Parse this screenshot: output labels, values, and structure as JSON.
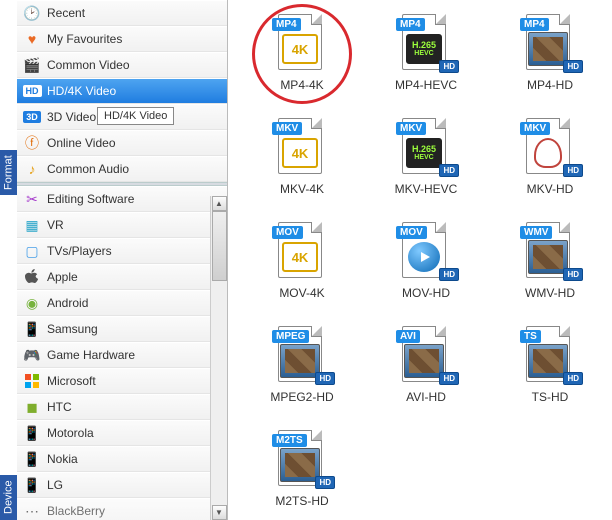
{
  "sidebar": {
    "format_tab": "Format",
    "device_tab": "Device",
    "items": [
      {
        "label": "Recent",
        "icon": "🕑"
      },
      {
        "label": "My Favourites",
        "icon": "♥"
      },
      {
        "label": "Common Video",
        "icon": "🎬"
      },
      {
        "label": "HD/4K Video",
        "icon": "HD"
      },
      {
        "label": "3D Video",
        "icon": "3D"
      },
      {
        "label": "Online Video",
        "icon": "ⓕ"
      },
      {
        "label": "Common Audio",
        "icon": "♪"
      },
      {
        "label": "Editing Software",
        "icon": "✂"
      },
      {
        "label": "VR",
        "icon": "▦"
      },
      {
        "label": "TVs/Players",
        "icon": "▢"
      },
      {
        "label": "Apple",
        "icon": ""
      },
      {
        "label": "Android",
        "icon": "◉"
      },
      {
        "label": "Samsung",
        "icon": "📱"
      },
      {
        "label": "Game Hardware",
        "icon": "🎮"
      },
      {
        "label": "Microsoft",
        "icon": "⊞"
      },
      {
        "label": "HTC",
        "icon": "◼"
      },
      {
        "label": "Motorola",
        "icon": "📱"
      },
      {
        "label": "Nokia",
        "icon": "📱"
      },
      {
        "label": "LG",
        "icon": "📱"
      },
      {
        "label": "BlackBerry",
        "icon": "⋯"
      }
    ],
    "selected_index": 3,
    "tooltip": "HD/4K Video"
  },
  "formats": [
    {
      "ext": "MP4",
      "inner": "4K",
      "kind": "4k",
      "label": "MP4-4K",
      "highlighted": true
    },
    {
      "ext": "MP4",
      "inner": "H.265",
      "sub": "HEVC",
      "kind": "hevc",
      "label": "MP4-HEVC"
    },
    {
      "ext": "MP4",
      "kind": "thumb",
      "label": "MP4-HD"
    },
    {
      "ext": "MKV",
      "inner": "4K",
      "kind": "4k",
      "label": "MKV-4K"
    },
    {
      "ext": "MKV",
      "inner": "H.265",
      "sub": "HEVC",
      "kind": "hevc",
      "label": "MKV-HEVC"
    },
    {
      "ext": "MKV",
      "kind": "matro",
      "label": "MKV-HD"
    },
    {
      "ext": "MOV",
      "inner": "4K",
      "kind": "4k",
      "label": "MOV-4K"
    },
    {
      "ext": "MOV",
      "kind": "play",
      "label": "MOV-HD"
    },
    {
      "ext": "WMV",
      "kind": "thumb",
      "label": "WMV-HD"
    },
    {
      "ext": "MPEG",
      "kind": "thumb",
      "label": "MPEG2-HD"
    },
    {
      "ext": "AVI",
      "kind": "thumb",
      "label": "AVI-HD"
    },
    {
      "ext": "TS",
      "kind": "thumb",
      "label": "TS-HD"
    },
    {
      "ext": "M2TS",
      "kind": "thumb",
      "label": "M2TS-HD"
    }
  ],
  "hd_corner": "HD"
}
